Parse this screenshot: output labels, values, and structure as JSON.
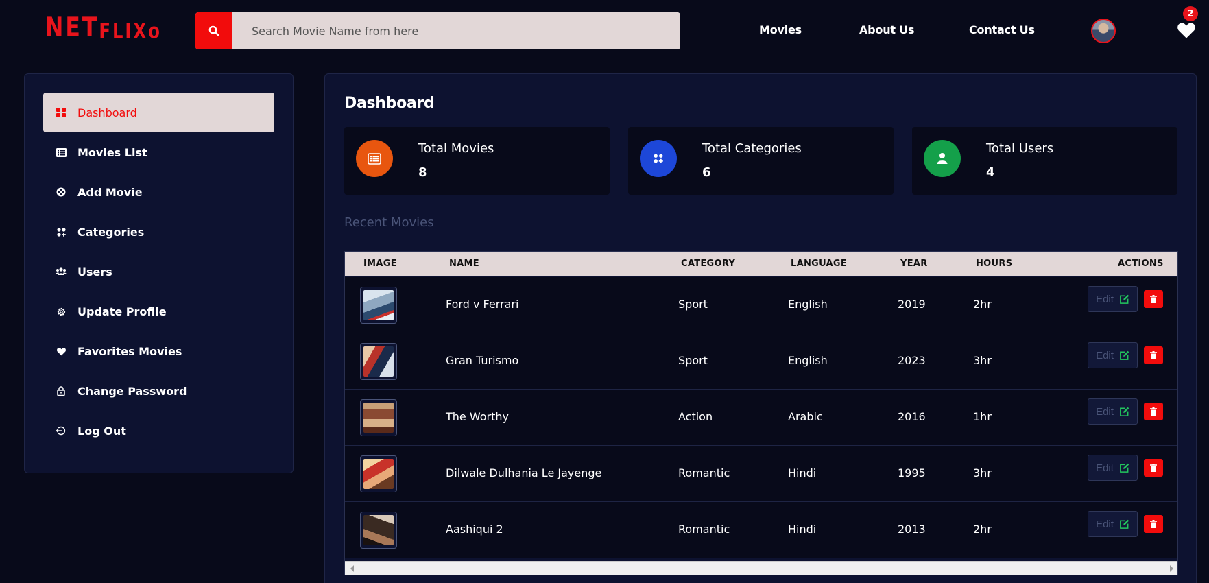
{
  "header": {
    "logo_big": "NET",
    "logo_small": "FLIXo",
    "search_placeholder": "Search Movie Name from here",
    "nav": [
      "Movies",
      "About Us",
      "Contact Us"
    ],
    "favorites_count": "2",
    "icons": {
      "search": "search-icon",
      "favorites": "heart-icon",
      "profile": "avatar"
    }
  },
  "sidebar": {
    "items": [
      {
        "label": "Dashboard",
        "icon": "dashboard-grid-icon",
        "active": true
      },
      {
        "label": "Movies List",
        "icon": "list-icon"
      },
      {
        "label": "Add Movie",
        "icon": "film-reel-icon"
      },
      {
        "label": "Categories",
        "icon": "categories-icon"
      },
      {
        "label": "Users",
        "icon": "users-icon"
      },
      {
        "label": "Update Profile",
        "icon": "gear-icon"
      },
      {
        "label": "Favorites Movies",
        "icon": "heart-icon"
      },
      {
        "label": "Change Password",
        "icon": "lock-icon"
      },
      {
        "label": "Log Out",
        "icon": "logout-icon"
      }
    ]
  },
  "main": {
    "title": "Dashboard",
    "stats": [
      {
        "label": "Total Movies",
        "value": "8",
        "color": "#e8560f",
        "icon": "list-icon"
      },
      {
        "label": "Total Categories",
        "value": "6",
        "color": "#1d47d8",
        "icon": "categories-icon"
      },
      {
        "label": "Total Users",
        "value": "4",
        "color": "#14a04a",
        "icon": "user-icon"
      }
    ],
    "recent_title": "Recent Movies",
    "table": {
      "columns": [
        "IMAGE",
        "NAME",
        "CATEGORY",
        "LANGUAGE",
        "YEAR",
        "HOURS",
        "ACTIONS"
      ],
      "rows": [
        {
          "name": "Ford v Ferrari",
          "category": "Sport",
          "language": "English",
          "year": "2019",
          "hours": "2hr"
        },
        {
          "name": "Gran Turismo",
          "category": "Sport",
          "language": "English",
          "year": "2023",
          "hours": "3hr"
        },
        {
          "name": "The Worthy",
          "category": "Action",
          "language": "Arabic",
          "year": "2016",
          "hours": "1hr"
        },
        {
          "name": "Dilwale Dulhania Le Jayenge",
          "category": "Romantic",
          "language": "Hindi",
          "year": "1995",
          "hours": "3hr"
        },
        {
          "name": "Aashiqui 2",
          "category": "Romantic",
          "language": "Hindi",
          "year": "2013",
          "hours": "2hr"
        }
      ],
      "edit_label": "Edit"
    }
  },
  "colors": {
    "background": "#080a1a",
    "panel": "#0d1230",
    "accent_red": "#f20c0c",
    "active_item_bg": "#e2d7d7",
    "edit_icon_green": "#22c55e"
  }
}
